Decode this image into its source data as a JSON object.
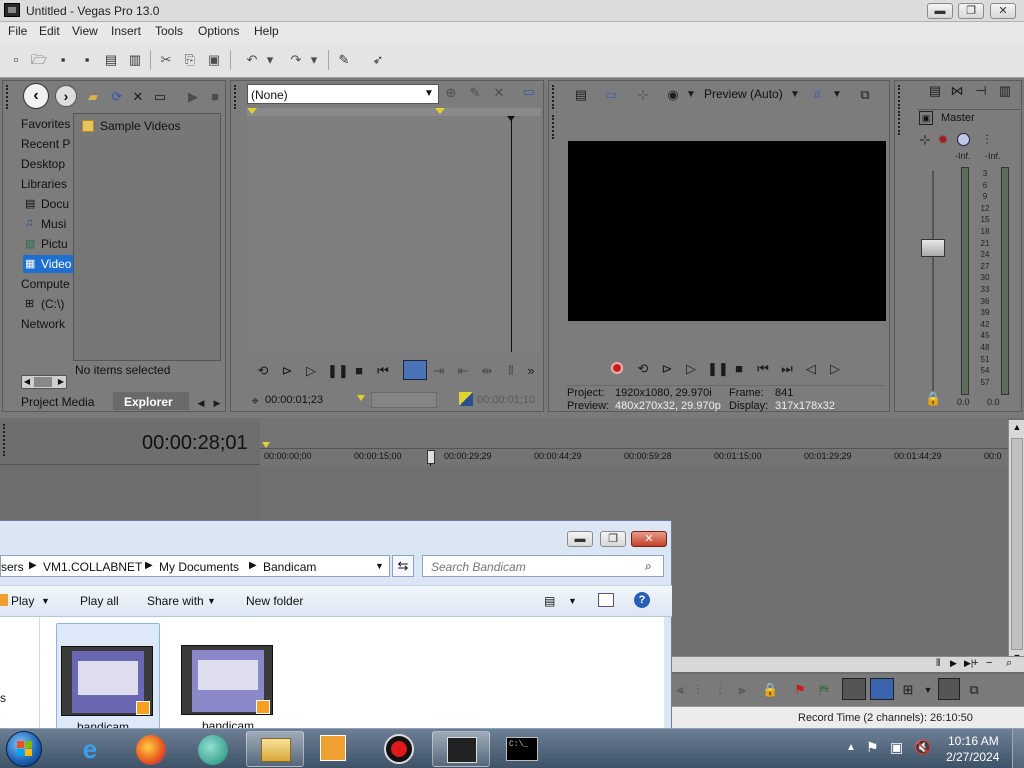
{
  "window": {
    "title": "Untitled - Vegas Pro 13.0",
    "min_label": "▬",
    "max_label": "❐",
    "close_label": "✕"
  },
  "menu": [
    "File",
    "Edit",
    "View",
    "Insert",
    "Tools",
    "Options",
    "Help"
  ],
  "explorer_panel": {
    "tree": [
      "Favorites",
      "Recent P",
      "Desktop",
      "Libraries",
      "Docu",
      "Musi",
      "Pictu",
      "Video",
      "Compute",
      "(C:\\)",
      "Network"
    ],
    "folder": "Sample Videos",
    "status": "No items selected",
    "tabs": [
      "Project Media",
      "Explorer"
    ]
  },
  "trimmer": {
    "dropdown_value": "(None)",
    "time_in": "00:00:01;23",
    "time_out": "00:00:01;10"
  },
  "preview": {
    "mode_label": "Preview (Auto)",
    "project_label": "Project:",
    "project_value": "1920x1080, 29.970i",
    "preview_label": "Preview:",
    "preview_value": "480x270x32, 29.970p",
    "frame_label": "Frame:",
    "frame_value": "841",
    "display_label": "Display:",
    "display_value": "317x178x32"
  },
  "master": {
    "label": "Master",
    "inf_left": "-Inf.",
    "inf_right": "-Inf.",
    "scale": [
      "3",
      "6",
      "9",
      "12",
      "15",
      "18",
      "21",
      "24",
      "27",
      "30",
      "33",
      "36",
      "39",
      "42",
      "45",
      "48",
      "51",
      "54",
      "57"
    ],
    "bottom_left": "0.0",
    "bottom_right": "0.0"
  },
  "timeline": {
    "current_time": "00:00:28;01",
    "ruler": [
      "00:00:00;00",
      "00:00:15;00",
      "00:00:29;29",
      "00:00:44;29",
      "00:00:59;28",
      "00:01:15;00",
      "00:01:29;29",
      "00:01:44;29",
      "00:0"
    ],
    "record_time": "Record Time (2 channels): 26:10:50"
  },
  "file_dialog": {
    "breadcrumb": [
      "sers",
      "VM1.COLLABNET",
      "My Documents",
      "Bandicam"
    ],
    "search_placeholder": "Search Bandicam",
    "toolbar": [
      "Play",
      "Play all",
      "Share with",
      "New folder"
    ],
    "files": [
      "bandicam",
      "bandicam"
    ],
    "left_letter": "s"
  },
  "taskbar": {
    "time": "10:16 AM",
    "date": "2/27/2024",
    "cmd_text": "C:\\_"
  }
}
